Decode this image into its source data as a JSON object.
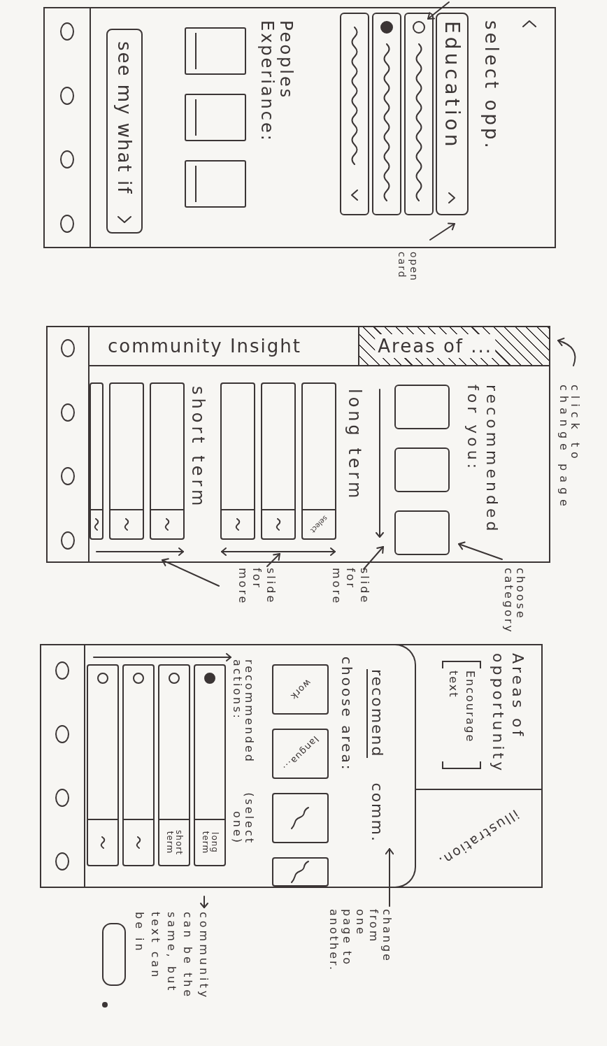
{
  "select_screen": {
    "title": "select opp.",
    "dropdown": {
      "value": "Education"
    },
    "options": [
      {
        "kind": "radio",
        "selected": false
      },
      {
        "kind": "radio",
        "selected": true
      },
      {
        "kind": "more"
      }
    ],
    "experiences_title": "Peoples Experiance:",
    "action_button": "see my what if",
    "note": "open card"
  },
  "insight_screen": {
    "tabs": [
      {
        "label": "community Insight",
        "selected": true
      },
      {
        "label": "Areas of ...",
        "selected": false
      }
    ],
    "recommended_title": "recommended for you:",
    "groups": [
      {
        "title": "long term",
        "kind": "twoway",
        "rows": [
          {
            "kind": "text",
            "text": "select"
          },
          {
            "kind": "squiggle"
          },
          {
            "kind": "squiggle"
          }
        ]
      },
      {
        "title": "short term",
        "kind": "oneway",
        "rows": [
          {
            "kind": "squiggle"
          },
          {
            "kind": "squiggle"
          },
          {
            "kind": "squiggle"
          }
        ]
      }
    ],
    "notes": {
      "tabs": "click to change page",
      "categories": "choose category",
      "slides": [
        "slide for more",
        "slide for more"
      ]
    }
  },
  "areas_screen": {
    "title": "Areas of opportunity",
    "placeholder_text": "Encourage text",
    "illustration_label": "illustration.",
    "tabs": [
      {
        "label": "recomend",
        "selected": true
      },
      {
        "label": "comm.",
        "selected": false
      }
    ],
    "areas_title": "choose area:",
    "areas": [
      {
        "kind": "label",
        "label": "work"
      },
      {
        "kind": "label",
        "label": "langua..."
      },
      {
        "kind": "squiggle"
      },
      {
        "kind": "squiggle"
      }
    ],
    "actions_title": "recommended actions:",
    "actions_hint": "(select one)",
    "actions": [
      {
        "kind": "tag",
        "tag": "long term",
        "selected": true
      },
      {
        "kind": "tag",
        "tag": "short term",
        "selected": false
      },
      {
        "kind": "squiggle",
        "selected": false
      },
      {
        "kind": "squiggle",
        "selected": false
      }
    ],
    "notes": {
      "tabs": "change from one page to another.",
      "community": "community can be the same, but text can be in"
    }
  }
}
